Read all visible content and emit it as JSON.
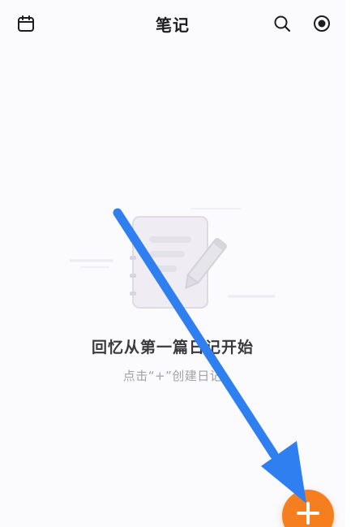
{
  "header": {
    "title": "笔记",
    "left_icon": "calendar-icon",
    "right_icons": [
      "search-icon",
      "record-icon"
    ]
  },
  "empty_state": {
    "title": "回忆从第一篇日记开始",
    "subtitle": "点击“+”创建日记",
    "illustration": "notebook-pencil-icon"
  },
  "fab": {
    "icon": "plus-icon",
    "color": "#f57f1f"
  },
  "annotation": {
    "icon": "arrow-pointer",
    "color": "#2f7ff0"
  }
}
